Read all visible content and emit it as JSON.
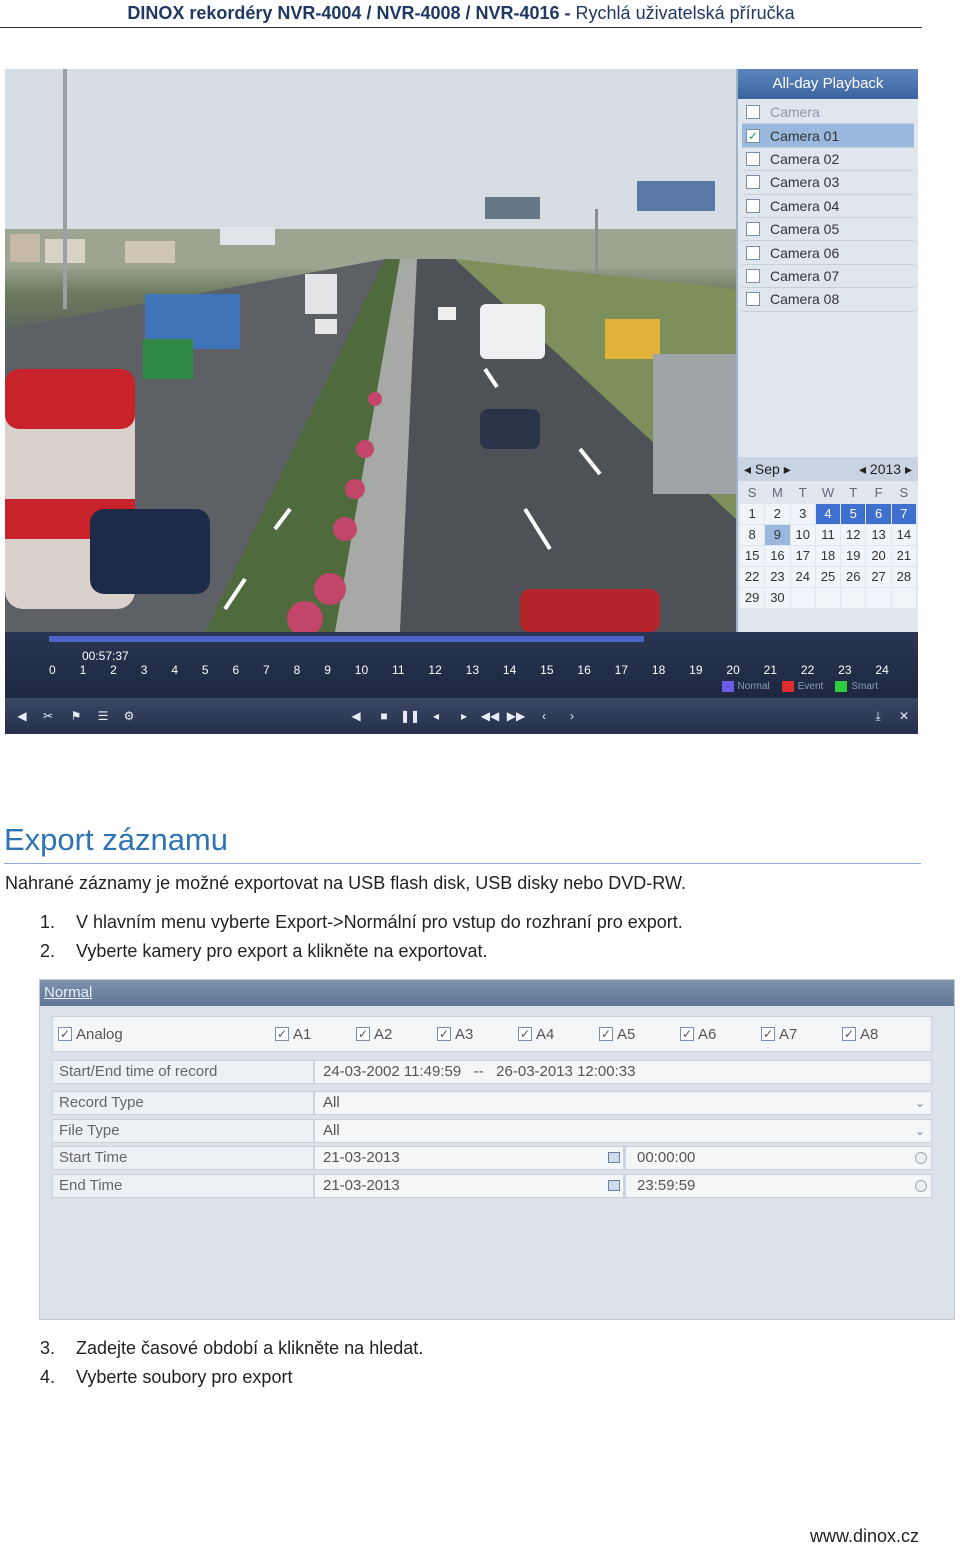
{
  "header": {
    "bold": "DINOX rekordéry NVR-4004 / NVR-4008 / NVR-4016 -",
    "rest": "Rychlá uživatelská příručka"
  },
  "playback": {
    "panel_title": "All-day Playback",
    "camera_header": "Camera",
    "cameras": [
      "Camera 01",
      "Camera 02",
      "Camera 03",
      "Camera 04",
      "Camera 05",
      "Camera 06",
      "Camera 07",
      "Camera 08"
    ],
    "calendar": {
      "month": "Sep",
      "year": "2013",
      "dow": [
        "S",
        "M",
        "T",
        "W",
        "T",
        "F",
        "S"
      ],
      "days": [
        "1",
        "2",
        "3",
        "4",
        "5",
        "6",
        "7",
        "8",
        "9",
        "10",
        "11",
        "12",
        "13",
        "14",
        "15",
        "16",
        "17",
        "18",
        "19",
        "20",
        "21",
        "22",
        "23",
        "24",
        "25",
        "26",
        "27",
        "28",
        "29",
        "30"
      ]
    },
    "time": "00:57:37",
    "hours": [
      "0",
      "1",
      "2",
      "3",
      "4",
      "5",
      "6",
      "7",
      "8",
      "9",
      "10",
      "11",
      "12",
      "13",
      "14",
      "15",
      "16",
      "17",
      "18",
      "19",
      "20",
      "21",
      "22",
      "23",
      "24"
    ],
    "legend": {
      "normal": "Normal",
      "event": "Event",
      "smart": "Smart"
    },
    "colors": {
      "normal": "#6c5ce7",
      "event": "#e02c2c",
      "smart": "#2ecc40"
    }
  },
  "section": {
    "title": "Export záznamu",
    "intro": "Nahrané záznamy je možné exportovat na USB flash disk, USB disky nebo DVD-RW.",
    "steps": [
      {
        "n": "1.",
        "text": "V hlavním menu vyberte Export->Normální pro vstup do rozhraní pro export."
      },
      {
        "n": "2.",
        "text": "Vyberte kamery pro export a klikněte na exportovat."
      },
      {
        "n": "3.",
        "text": "Zadejte časové období a klikněte na hledat."
      },
      {
        "n": "4.",
        "text": "Vyberte soubory pro export"
      }
    ]
  },
  "dialog": {
    "title": "Normal",
    "analog_label": "Analog",
    "channels": [
      "A1",
      "A2",
      "A3",
      "A4",
      "A5",
      "A6",
      "A7",
      "A8"
    ],
    "start_end_label": "Start/End time of record",
    "start_end_value": "24-03-2002 11:49:59   --   26-03-2013 12:00:33",
    "record_type_label": "Record Type",
    "record_type_value": "All",
    "file_type_label": "File Type",
    "file_type_value": "All",
    "start_time_label": "Start Time",
    "start_date": "21-03-2013",
    "start_clock": "00:00:00",
    "end_time_label": "End Time",
    "end_date": "21-03-2013",
    "end_clock": "23:59:59"
  },
  "footer": {
    "url": "www.dinox.cz"
  }
}
